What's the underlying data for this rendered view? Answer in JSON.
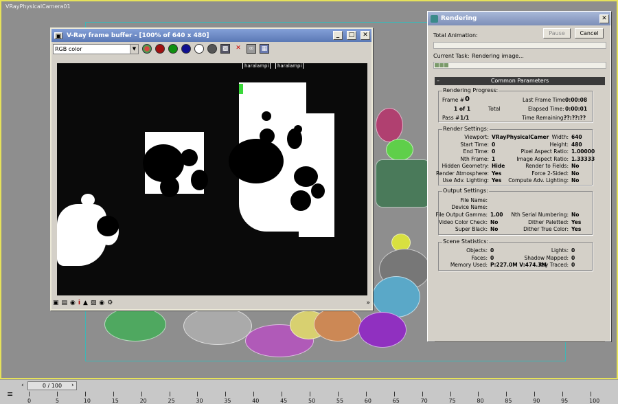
{
  "viewport": {
    "label": "VRayPhysicalCamera01"
  },
  "vfb": {
    "title": "V-Ray frame buffer - [100% of 640 x 480]",
    "channel": "RGB color",
    "tags": [
      "haralampi",
      "haralampi"
    ]
  },
  "rendering": {
    "title": "Rendering",
    "total_animation_label": "Total Animation:",
    "pause_label": "Pause",
    "cancel_label": "Cancel",
    "current_task_label": "Current Task:",
    "current_task_value": "Rendering image...",
    "panel_title": "Common Parameters",
    "progress": {
      "title": "Rendering Progress:",
      "frame_label": "Frame #",
      "frame_value": "0",
      "of_value": "1 of 1",
      "total_label": "Total",
      "pass_label": "Pass #",
      "pass_value": "1/1",
      "last_frame_label": "Last Frame Time:",
      "last_frame_value": "0:00:08",
      "elapsed_label": "Elapsed Time:",
      "elapsed_value": "0:00:01",
      "remaining_label": "Time Remaining:",
      "remaining_value": "??:??:??"
    },
    "render_settings": {
      "title": "Render Settings:",
      "left": [
        {
          "k": "Viewport:",
          "v": "VRayPhysicalCamer"
        },
        {
          "k": "Start Time:",
          "v": "0"
        },
        {
          "k": "End Time:",
          "v": "0"
        },
        {
          "k": "Nth Frame:",
          "v": "1"
        },
        {
          "k": "Hidden Geometry:",
          "v": "Hide"
        },
        {
          "k": "Render Atmosphere:",
          "v": "Yes"
        },
        {
          "k": "Use Adv. Lighting:",
          "v": "Yes"
        }
      ],
      "right": [
        {
          "k": "Width:",
          "v": "640"
        },
        {
          "k": "Height:",
          "v": "480"
        },
        {
          "k": "Pixel Aspect Ratio:",
          "v": "1.00000"
        },
        {
          "k": "Image Aspect Ratio:",
          "v": "1.33333"
        },
        {
          "k": "Render to Fields:",
          "v": "No"
        },
        {
          "k": "Force 2-Sided:",
          "v": "No"
        },
        {
          "k": "Compute Adv. Lighting:",
          "v": "No"
        }
      ]
    },
    "output_settings": {
      "title": "Output Settings:",
      "file_name_label": "File Name:",
      "device_name_label": "Device Name:",
      "left": [
        {
          "k": "File Output Gamma:",
          "v": "1.00"
        },
        {
          "k": "Video Color Check:",
          "v": "No"
        },
        {
          "k": "Super Black:",
          "v": "No"
        }
      ],
      "right": [
        {
          "k": "Nth Serial Numbering:",
          "v": "No"
        },
        {
          "k": "Dither Paletted:",
          "v": "Yes"
        },
        {
          "k": "Dither True Color:",
          "v": "Yes"
        }
      ]
    },
    "scene_stats": {
      "title": "Scene Statistics:",
      "left": [
        {
          "k": "Objects:",
          "v": "0"
        },
        {
          "k": "Faces:",
          "v": "0"
        },
        {
          "k": "Memory Used:",
          "v": "P:227.0M V:474.3M"
        }
      ],
      "right": [
        {
          "k": "Lights:",
          "v": "0"
        },
        {
          "k": "Shadow Mapped:",
          "v": "0"
        },
        {
          "k": "Ray Traced:",
          "v": "0"
        }
      ]
    }
  },
  "timeline": {
    "slider": "0 / 100",
    "ticks": [
      "0",
      "5",
      "10",
      "15",
      "20",
      "25",
      "30",
      "35",
      "40",
      "45",
      "50",
      "55",
      "60",
      "65",
      "70",
      "75",
      "80",
      "85",
      "90",
      "95",
      "100"
    ]
  }
}
